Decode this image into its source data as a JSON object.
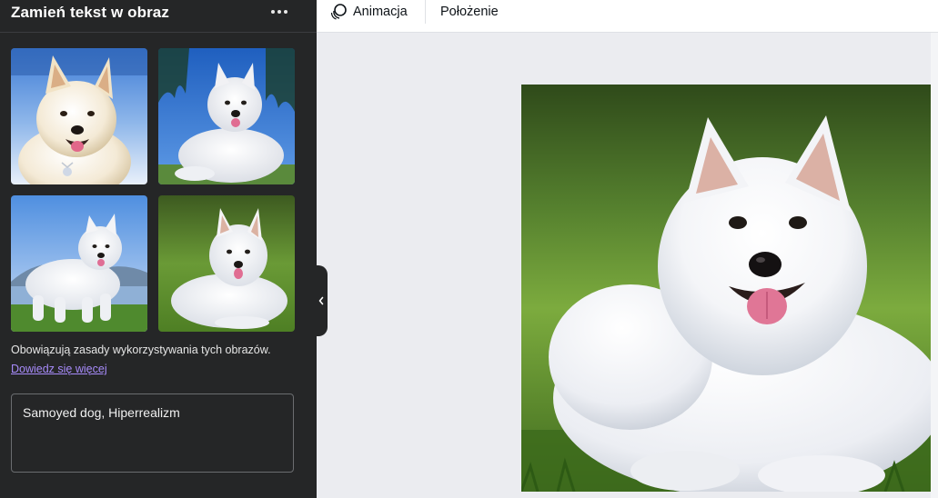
{
  "panel": {
    "title": "Zamień tekst w obraz",
    "usage_note": "Obowiązują zasady wykorzystywania tych obrazów.",
    "learn_more": "Dowiedz się więcej",
    "prompt_value": "Samoyed dog, Hiperrealizm"
  },
  "toolbar": {
    "animation_label": "Animacja",
    "position_label": "Położenie"
  },
  "icons": {
    "more": "more-horizontal-icon",
    "animation": "animation-icon",
    "collapse": "chevron-left-icon"
  },
  "colors": {
    "panel_bg": "#252627",
    "link": "#a78bfa",
    "canvas_bg": "#ebecf0"
  }
}
